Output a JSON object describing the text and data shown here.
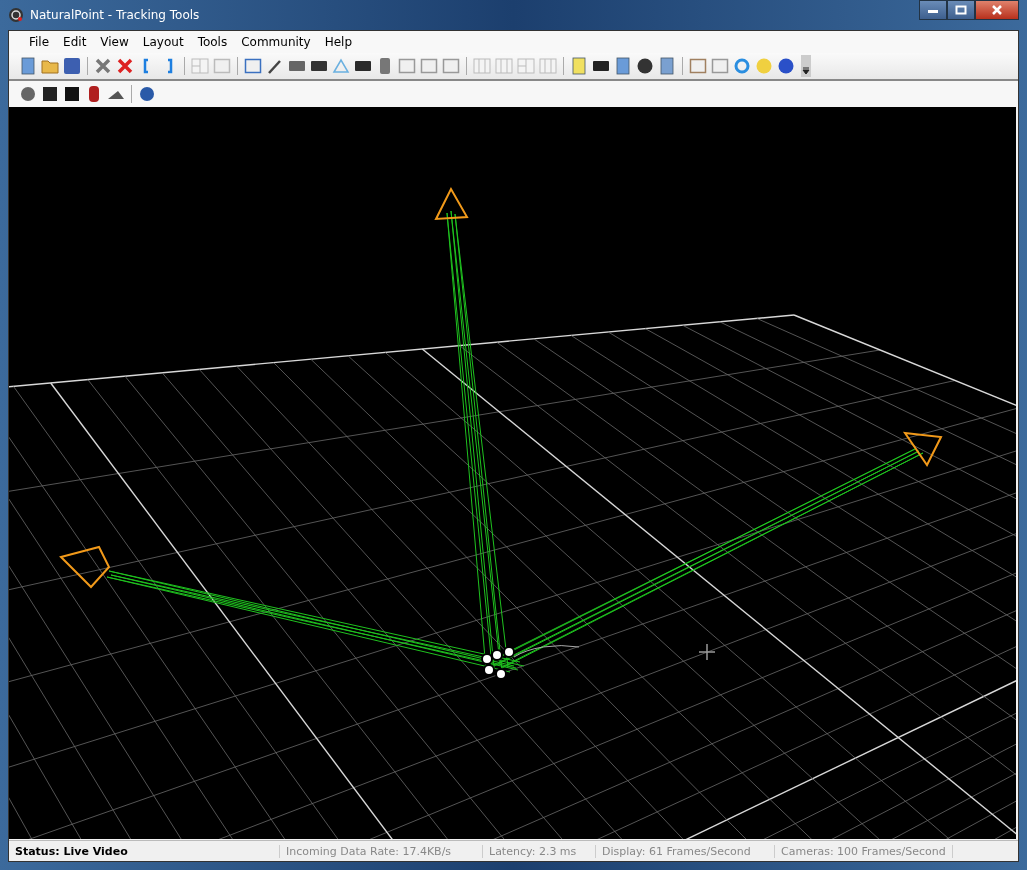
{
  "window": {
    "title": "NaturalPoint - Tracking Tools"
  },
  "menu": [
    {
      "label": "File"
    },
    {
      "label": "Edit"
    },
    {
      "label": "View"
    },
    {
      "label": "Layout"
    },
    {
      "label": "Tools"
    },
    {
      "label": "Community"
    },
    {
      "label": "Help"
    }
  ],
  "status_bar": [
    {
      "kind": "status",
      "text": "Status: Live Video"
    },
    {
      "kind": "metric",
      "text": "Incoming Data Rate: 17.4KB/s"
    },
    {
      "kind": "metric",
      "text": "Latency: 2.3 ms"
    },
    {
      "kind": "metric",
      "text": "Display: 61 Frames/Second"
    },
    {
      "kind": "metric",
      "text": "Cameras: 100 Frames/Second"
    }
  ]
}
